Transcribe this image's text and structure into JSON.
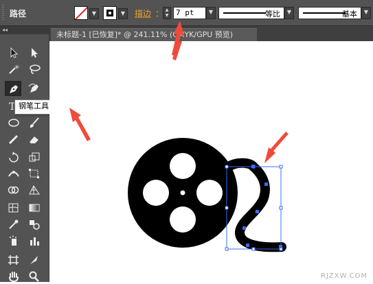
{
  "control_bar": {
    "selection_label": "路径",
    "stroke_label": "描边",
    "stroke_colon": "：",
    "stroke_weight": "7 pt",
    "profile_value": "等比",
    "brush_value": "基本"
  },
  "document_tab": {
    "title": "未标题-1 [已恢复]* @ 241.11% (CMYK/GPU 预览)"
  },
  "tools_panel": {
    "collapse_glyph": "◂◂"
  },
  "tooltip": {
    "text": "钢笔工具 (P)"
  },
  "canvas": {
    "watermark": "RJZXW.COM"
  },
  "colors": {
    "annotation_arrow": "#f04a3a",
    "selection": "#3a6cf5",
    "stroke_accent": "#f0a030"
  }
}
